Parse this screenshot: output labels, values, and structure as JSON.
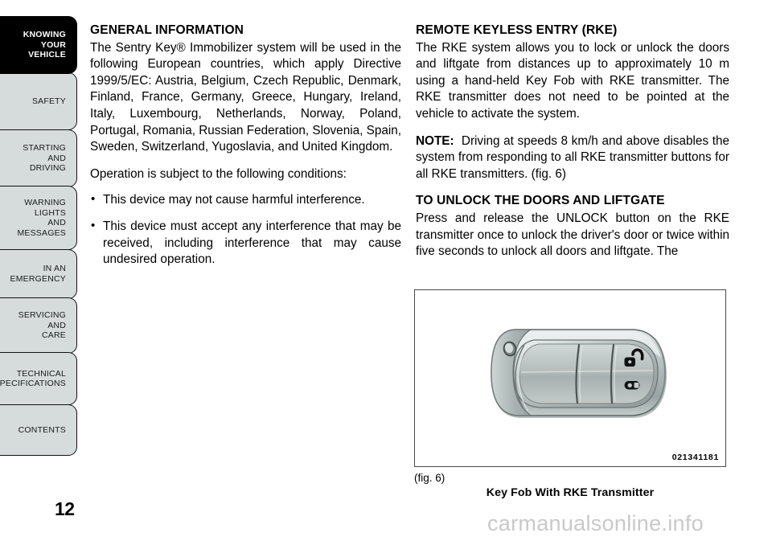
{
  "sidebar": {
    "tabs": [
      {
        "name": "knowing-your-vehicle",
        "lines": [
          "KNOWING",
          "YOUR",
          "VEHICLE"
        ],
        "active": true
      },
      {
        "name": "safety",
        "lines": [
          "SAFETY"
        ],
        "active": false
      },
      {
        "name": "starting-and-driving",
        "lines": [
          "STARTING",
          "AND",
          "DRIVING"
        ],
        "active": false
      },
      {
        "name": "warning-lights-and-messages",
        "lines": [
          "WARNING",
          "LIGHTS",
          "AND",
          "MESSAGES"
        ],
        "active": false
      },
      {
        "name": "in-an-emergency",
        "lines": [
          "IN AN",
          "EMERGENCY"
        ],
        "active": false
      },
      {
        "name": "servicing-and-care",
        "lines": [
          "SERVICING",
          "AND",
          "CARE"
        ],
        "active": false
      },
      {
        "name": "technical-specifications",
        "lines": [
          "TECHNICAL",
          "SPECIFICATIONS"
        ],
        "active": false
      },
      {
        "name": "contents",
        "lines": [
          "CONTENTS"
        ],
        "active": false
      }
    ]
  },
  "page_number": "12",
  "left_column": {
    "heading": "GENERAL INFORMATION",
    "paragraph_1": "The Sentry Key® Immobilizer system will be used in the following European countries, which apply Directive 1999/5/EC: Austria, Belgium, Czech Republic, Denmark, Finland, France, Germany, Greece, Hungary, Ireland, Italy, Luxembourg, Netherlands, Norway, Poland, Portugal, Romania, Russian Federation, Slovenia, Spain, Sweden, Switzerland, Yugoslavia, and United Kingdom.",
    "paragraph_2": "Operation is subject to the following conditions:",
    "bullets": [
      "This device may not cause harmful interference.",
      "This device must accept any interference that may be received, including interference that may cause undesired operation."
    ]
  },
  "right_column": {
    "heading_1": "REMOTE KEYLESS ENTRY (RKE)",
    "paragraph_1": "The RKE system allows you to lock or unlock the doors and liftgate from distances up to approximately 10 m using a hand-held Key Fob with RKE transmitter. The RKE transmitter does not need to be pointed at the vehicle to activate the system.",
    "note_label": "NOTE:",
    "note_text": "Driving at speeds 8 km/h and above disables the system from responding to all RKE transmitter buttons for all RKE transmitters.  (fig.  6)",
    "heading_2": "TO UNLOCK THE DOORS AND LIFTGATE",
    "paragraph_2": "Press and release the UNLOCK button on the RKE transmitter once to unlock the driver's door or twice within five seconds to unlock all doors and liftgate. The"
  },
  "figure": {
    "image_code": "021341181",
    "label": "(fig. 6)",
    "caption": "Key Fob With RKE Transmitter",
    "alt": "key-fob-with-rke-transmitter"
  },
  "watermark": "carmanualsonline.info",
  "colors": {
    "tab_inactive_bg": "#d6dcdc",
    "tab_active_bg": "#000000",
    "figure_border": "#4a4a4a",
    "watermark": "#c9c9c9"
  }
}
